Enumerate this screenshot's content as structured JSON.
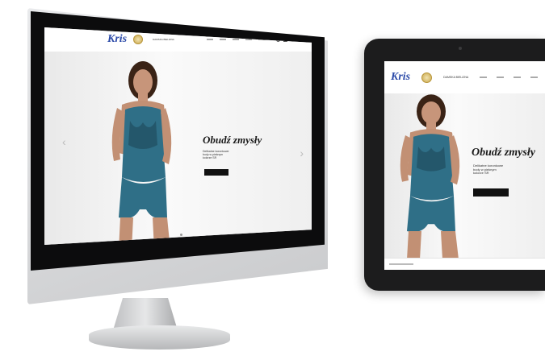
{
  "site": {
    "logo": "Kris",
    "nav_text": "DAMSKA BIELIZNA",
    "nav_links": [
      "",
      "",
      "",
      "",
      "",
      ""
    ]
  },
  "hero": {
    "headline": "Obudź zmysły",
    "subtext": "Delikatne koronkowe\nbody w pieknym\nkolorze SR",
    "cta_label": "",
    "prev_arrow": "‹",
    "next_arrow": "›"
  },
  "colors": {
    "logo": "#2b4aa8",
    "lingerie": "#2f6f87",
    "skin": "#b9876a",
    "hair": "#3a2316",
    "cta": "#111111"
  },
  "icons": [
    "search-icon",
    "cart-icon"
  ]
}
